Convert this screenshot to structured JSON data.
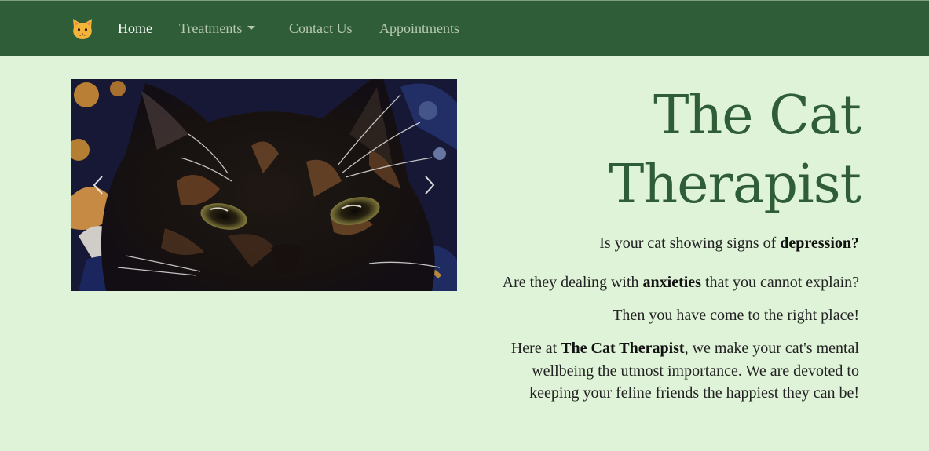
{
  "nav": {
    "brand_icon": "cat-face-icon",
    "items": [
      {
        "label": "Home",
        "active": true
      },
      {
        "label": "Treatments",
        "dropdown": true
      },
      {
        "label": "Contact Us"
      },
      {
        "label": "Appointments"
      }
    ]
  },
  "carousel": {
    "image_alt": "tortoiseshell cat face close-up",
    "prev_icon": "chevron-left-icon",
    "next_icon": "chevron-right-icon"
  },
  "hero": {
    "title": "The Cat Therapist",
    "p1": {
      "before": "Is your cat showing signs of ",
      "bold": "depression?"
    },
    "p2": {
      "before": "Are they dealing with ",
      "bold": "anxieties",
      "after": " that you cannot explain?"
    },
    "p3": "Then you have come to the right place!",
    "p4": {
      "before": "Here at ",
      "bold": "The Cat Therapist",
      "after": ", we make your cat's mental wellbeing the utmost importance. We are devoted to keeping your feline friends the happiest they can be!"
    }
  },
  "colors": {
    "nav_bg": "#2f5d37",
    "page_bg": "#dff3d8",
    "title": "#2f5d37"
  }
}
